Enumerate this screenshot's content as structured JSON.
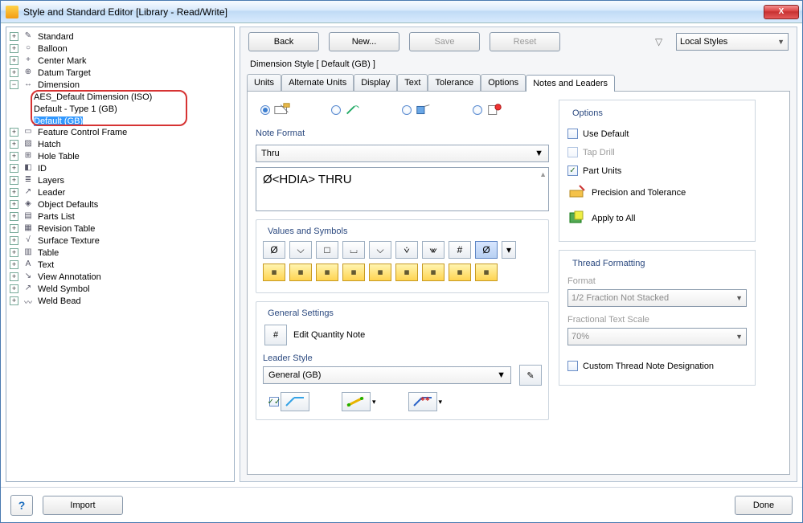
{
  "window": {
    "title": "Style and Standard Editor [Library - Read/Write]"
  },
  "toolbar": {
    "back": "Back",
    "new": "New...",
    "save": "Save",
    "reset": "Reset",
    "filter_combo": "Local Styles"
  },
  "style_header": "Dimension Style [ Default (GB) ]",
  "tree": {
    "standard": "Standard",
    "balloon": "Balloon",
    "center_mark": "Center Mark",
    "datum_target": "Datum Target",
    "dimension": "Dimension",
    "dim_aes": "AES_Default Dimension (ISO)",
    "dim_type1": "Default - Type 1 (GB)",
    "dim_gb": "Default (GB)",
    "fcf": "Feature Control Frame",
    "hatch": "Hatch",
    "hole_table": "Hole Table",
    "id": "ID",
    "layers": "Layers",
    "leader": "Leader",
    "obj_defaults": "Object Defaults",
    "parts_list": "Parts List",
    "revision_table": "Revision Table",
    "surface_texture": "Surface Texture",
    "table": "Table",
    "text": "Text",
    "view_annotation": "View Annotation",
    "weld_symbol": "Weld Symbol",
    "weld_bead": "Weld Bead"
  },
  "tabs": {
    "units": "Units",
    "alt_units": "Alternate Units",
    "display": "Display",
    "text": "Text",
    "tolerance": "Tolerance",
    "options": "Options",
    "notes_leaders": "Notes and Leaders"
  },
  "note_format": {
    "label": "Note Format",
    "selected": "Thru",
    "body": "Ø<HDIA> THRU"
  },
  "values_symbols_label": "Values and Symbols",
  "general": {
    "label": "General Settings",
    "edit_qty": "Edit Quantity Note",
    "leader_label": "Leader Style",
    "leader_value": "General (GB)"
  },
  "options": {
    "label": "Options",
    "use_default": "Use Default",
    "tap_drill": "Tap Drill",
    "part_units": "Part Units",
    "precision": "Precision and Tolerance",
    "apply_all": "Apply to All"
  },
  "thread": {
    "label": "Thread Formatting",
    "format_label": "Format",
    "format_value": "1/2 Fraction Not Stacked",
    "scale_label": "Fractional Text Scale",
    "scale_value": "70%",
    "custom": "Custom Thread Note Designation"
  },
  "footer": {
    "import": "Import",
    "done": "Done"
  }
}
